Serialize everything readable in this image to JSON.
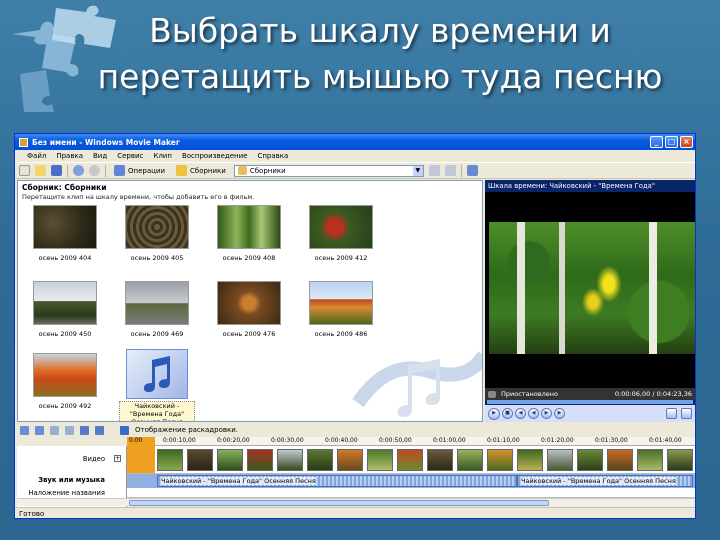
{
  "slide": {
    "title": "Выбрать шкалу времени и\nперетащить мышью туда песню"
  },
  "window": {
    "title": "Без имени - Windows Movie Maker",
    "controls": {
      "minimize": "_",
      "maximize": "□",
      "close": "×"
    }
  },
  "menu": [
    "Файл",
    "Правка",
    "Вид",
    "Сервис",
    "Клип",
    "Воспроизведение",
    "Справка"
  ],
  "toolbar": {
    "operations_label": "Операции",
    "collections_label": "Сборники",
    "combo_value": "Сборники"
  },
  "collection": {
    "title": "Сборник: Сборники",
    "subtitle": "Перетащите клип на шкалу времени, чтобы добавить его в фильм.",
    "clips": [
      {
        "caption": "осень 2009 404",
        "palette": "dark"
      },
      {
        "caption": "осень 2009 405",
        "palette": "ground"
      },
      {
        "caption": "осень 2009 408",
        "palette": "forest"
      },
      {
        "caption": "осень 2009 412",
        "palette": "red"
      },
      {
        "caption": "осень 2009 450",
        "palette": "sky"
      },
      {
        "caption": "осень 2009 469",
        "palette": "road"
      },
      {
        "caption": "осень 2009 476",
        "palette": "leaves"
      },
      {
        "caption": "осень 2009 486",
        "palette": "autumn"
      },
      {
        "caption": "осень 2009 492",
        "palette": "orange"
      }
    ],
    "audio_clip_caption": "Чайковский - \"Времена Года\" Осенняя Песня"
  },
  "monitor": {
    "title": "Шкала времени: Чайковский - \"Времена Года\"",
    "status": "Приостановлено",
    "time": "0:00:06,00 / 0:04:23,36"
  },
  "timeline": {
    "toggle_label": "Отображение раскадровки.",
    "ticks": [
      "0.00",
      "0:00:10,00",
      "0:00:20,00",
      "0:00:30,00",
      "0:00:40,00",
      "0:00:50,00",
      "0:01:00,00",
      "0:01:10,00",
      "0:01:20,00",
      "0:01:30,00",
      "0:01:40,00"
    ],
    "tracks": {
      "video": "Видео",
      "audio": "Звук или музыка",
      "titles": "Наложение названия"
    },
    "audio_clips": [
      "Чайковский - \"Времена Года\" Осенняя Песня",
      "Чайковский - \"Времена Года\" Осенняя Песня"
    ]
  },
  "statusbar": {
    "text": "Готово"
  }
}
